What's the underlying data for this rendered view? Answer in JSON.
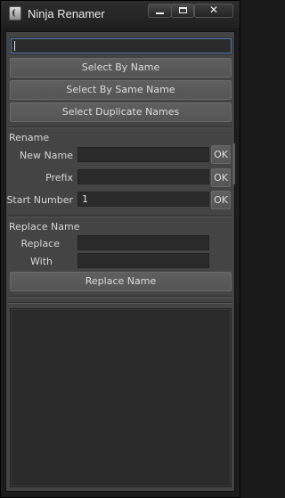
{
  "window": {
    "title": "Ninja Renamer",
    "close_glyph": "✕"
  },
  "search": {
    "value": ""
  },
  "select": {
    "by_name": "Select By Name",
    "by_same_name": "Select By Same Name",
    "duplicates": "Select Duplicate Names"
  },
  "rename": {
    "section": "Rename",
    "new_name_label": "New Name",
    "new_name_value": "",
    "prefix_label": "Prefix",
    "prefix_value": "",
    "start_number_label": "Start Number",
    "start_number_value": "1",
    "ok_label": "OK"
  },
  "replace": {
    "section": "Replace Name",
    "replace_label": "Replace",
    "replace_value": "",
    "with_label": "With",
    "with_value": "",
    "button": "Replace Name"
  },
  "output": {
    "text": ""
  }
}
